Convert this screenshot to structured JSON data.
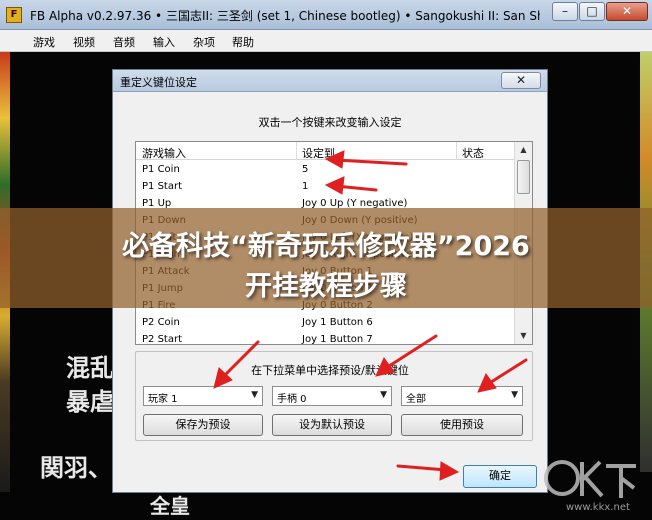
{
  "window": {
    "title": "FB Alpha v0.2.97.36 • 三国志II: 三圣剑 (set 1, Chinese bootleg) • Sangokushi II: San Shen...",
    "controls": {
      "minimize": "–",
      "maximize": "□",
      "close": "✕"
    }
  },
  "menu": [
    "游戏",
    "视频",
    "音频",
    "输入",
    "杂项",
    "帮助"
  ],
  "game_text": [
    "混乱",
    "暴虐",
    "関羽、",
    "全皇"
  ],
  "dialog": {
    "title": "重定义键位设定",
    "close": "✕",
    "instruction": "双击一个按键来改变输入设定",
    "columns": [
      "游戏输入",
      "设定到",
      "状态"
    ],
    "rows": [
      {
        "input": "P1 Coin",
        "mapping": "5"
      },
      {
        "input": "P1 Start",
        "mapping": "1"
      },
      {
        "input": "P1 Up",
        "mapping": "Joy 0 Up (Y negative)"
      },
      {
        "input": "P1 Down",
        "mapping": "Joy 0 Down (Y positive)"
      },
      {
        "input": "P1 Left",
        "mapping": "Joy 0 Left (X negative)"
      },
      {
        "input": "P1 Right",
        "mapping": "Joy 0 Right (X positive)"
      },
      {
        "input": "P1 Attack",
        "mapping": "Joy 0 Button 1"
      },
      {
        "input": "P1 Jump",
        "mapping": "Joy 0 Button 2"
      },
      {
        "input": "P1 Fire",
        "mapping": "Joy 0 Button 2"
      },
      {
        "input": "P2 Coin",
        "mapping": "Joy 1 Button 6"
      },
      {
        "input": "P2 Start",
        "mapping": "Joy 1 Button 7"
      }
    ],
    "preset_label": "在下拉菜单中选择预设/默认键位",
    "combos": [
      {
        "value": "玩家 1",
        "arrow": "▼"
      },
      {
        "value": "手柄 0",
        "arrow": "▼"
      },
      {
        "value": "全部",
        "arrow": "▼"
      }
    ],
    "buttons": [
      "保存为预设",
      "设为默认预设",
      "使用预设"
    ],
    "ok": "确定"
  },
  "banner": {
    "line1": "必备科技“新奇玩乐修改器”2026",
    "line2": "开挂教程步骤"
  },
  "watermark": {
    "text": "www.kkx.net",
    "logo": "KK下载"
  },
  "colors": {
    "arrow": "#e02020",
    "banner": "#915f2d"
  }
}
